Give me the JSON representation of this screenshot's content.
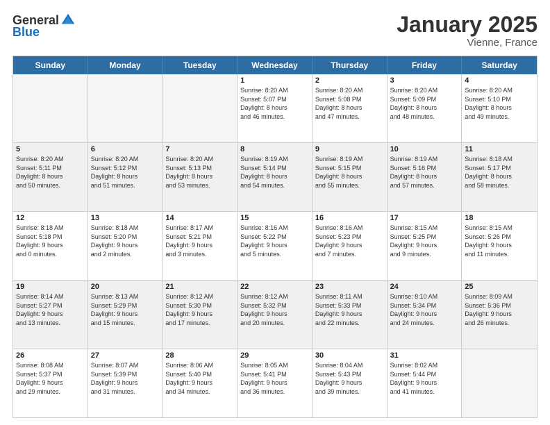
{
  "header": {
    "logo": {
      "general": "General",
      "blue": "Blue"
    },
    "title": "January 2025",
    "subtitle": "Vienne, France"
  },
  "weekdays": [
    "Sunday",
    "Monday",
    "Tuesday",
    "Wednesday",
    "Thursday",
    "Friday",
    "Saturday"
  ],
  "weeks": [
    [
      {
        "day": "",
        "info": "",
        "empty": true
      },
      {
        "day": "",
        "info": "",
        "empty": true
      },
      {
        "day": "",
        "info": "",
        "empty": true
      },
      {
        "day": "1",
        "info": "Sunrise: 8:20 AM\nSunset: 5:07 PM\nDaylight: 8 hours\nand 46 minutes."
      },
      {
        "day": "2",
        "info": "Sunrise: 8:20 AM\nSunset: 5:08 PM\nDaylight: 8 hours\nand 47 minutes."
      },
      {
        "day": "3",
        "info": "Sunrise: 8:20 AM\nSunset: 5:09 PM\nDaylight: 8 hours\nand 48 minutes."
      },
      {
        "day": "4",
        "info": "Sunrise: 8:20 AM\nSunset: 5:10 PM\nDaylight: 8 hours\nand 49 minutes."
      }
    ],
    [
      {
        "day": "5",
        "info": "Sunrise: 8:20 AM\nSunset: 5:11 PM\nDaylight: 8 hours\nand 50 minutes."
      },
      {
        "day": "6",
        "info": "Sunrise: 8:20 AM\nSunset: 5:12 PM\nDaylight: 8 hours\nand 51 minutes."
      },
      {
        "day": "7",
        "info": "Sunrise: 8:20 AM\nSunset: 5:13 PM\nDaylight: 8 hours\nand 53 minutes."
      },
      {
        "day": "8",
        "info": "Sunrise: 8:19 AM\nSunset: 5:14 PM\nDaylight: 8 hours\nand 54 minutes."
      },
      {
        "day": "9",
        "info": "Sunrise: 8:19 AM\nSunset: 5:15 PM\nDaylight: 8 hours\nand 55 minutes."
      },
      {
        "day": "10",
        "info": "Sunrise: 8:19 AM\nSunset: 5:16 PM\nDaylight: 8 hours\nand 57 minutes."
      },
      {
        "day": "11",
        "info": "Sunrise: 8:18 AM\nSunset: 5:17 PM\nDaylight: 8 hours\nand 58 minutes."
      }
    ],
    [
      {
        "day": "12",
        "info": "Sunrise: 8:18 AM\nSunset: 5:18 PM\nDaylight: 9 hours\nand 0 minutes."
      },
      {
        "day": "13",
        "info": "Sunrise: 8:18 AM\nSunset: 5:20 PM\nDaylight: 9 hours\nand 2 minutes."
      },
      {
        "day": "14",
        "info": "Sunrise: 8:17 AM\nSunset: 5:21 PM\nDaylight: 9 hours\nand 3 minutes."
      },
      {
        "day": "15",
        "info": "Sunrise: 8:16 AM\nSunset: 5:22 PM\nDaylight: 9 hours\nand 5 minutes."
      },
      {
        "day": "16",
        "info": "Sunrise: 8:16 AM\nSunset: 5:23 PM\nDaylight: 9 hours\nand 7 minutes."
      },
      {
        "day": "17",
        "info": "Sunrise: 8:15 AM\nSunset: 5:25 PM\nDaylight: 9 hours\nand 9 minutes."
      },
      {
        "day": "18",
        "info": "Sunrise: 8:15 AM\nSunset: 5:26 PM\nDaylight: 9 hours\nand 11 minutes."
      }
    ],
    [
      {
        "day": "19",
        "info": "Sunrise: 8:14 AM\nSunset: 5:27 PM\nDaylight: 9 hours\nand 13 minutes."
      },
      {
        "day": "20",
        "info": "Sunrise: 8:13 AM\nSunset: 5:29 PM\nDaylight: 9 hours\nand 15 minutes."
      },
      {
        "day": "21",
        "info": "Sunrise: 8:12 AM\nSunset: 5:30 PM\nDaylight: 9 hours\nand 17 minutes."
      },
      {
        "day": "22",
        "info": "Sunrise: 8:12 AM\nSunset: 5:32 PM\nDaylight: 9 hours\nand 20 minutes."
      },
      {
        "day": "23",
        "info": "Sunrise: 8:11 AM\nSunset: 5:33 PM\nDaylight: 9 hours\nand 22 minutes."
      },
      {
        "day": "24",
        "info": "Sunrise: 8:10 AM\nSunset: 5:34 PM\nDaylight: 9 hours\nand 24 minutes."
      },
      {
        "day": "25",
        "info": "Sunrise: 8:09 AM\nSunset: 5:36 PM\nDaylight: 9 hours\nand 26 minutes."
      }
    ],
    [
      {
        "day": "26",
        "info": "Sunrise: 8:08 AM\nSunset: 5:37 PM\nDaylight: 9 hours\nand 29 minutes."
      },
      {
        "day": "27",
        "info": "Sunrise: 8:07 AM\nSunset: 5:39 PM\nDaylight: 9 hours\nand 31 minutes."
      },
      {
        "day": "28",
        "info": "Sunrise: 8:06 AM\nSunset: 5:40 PM\nDaylight: 9 hours\nand 34 minutes."
      },
      {
        "day": "29",
        "info": "Sunrise: 8:05 AM\nSunset: 5:41 PM\nDaylight: 9 hours\nand 36 minutes."
      },
      {
        "day": "30",
        "info": "Sunrise: 8:04 AM\nSunset: 5:43 PM\nDaylight: 9 hours\nand 39 minutes."
      },
      {
        "day": "31",
        "info": "Sunrise: 8:02 AM\nSunset: 5:44 PM\nDaylight: 9 hours\nand 41 minutes."
      },
      {
        "day": "",
        "info": "",
        "empty": true
      }
    ]
  ]
}
